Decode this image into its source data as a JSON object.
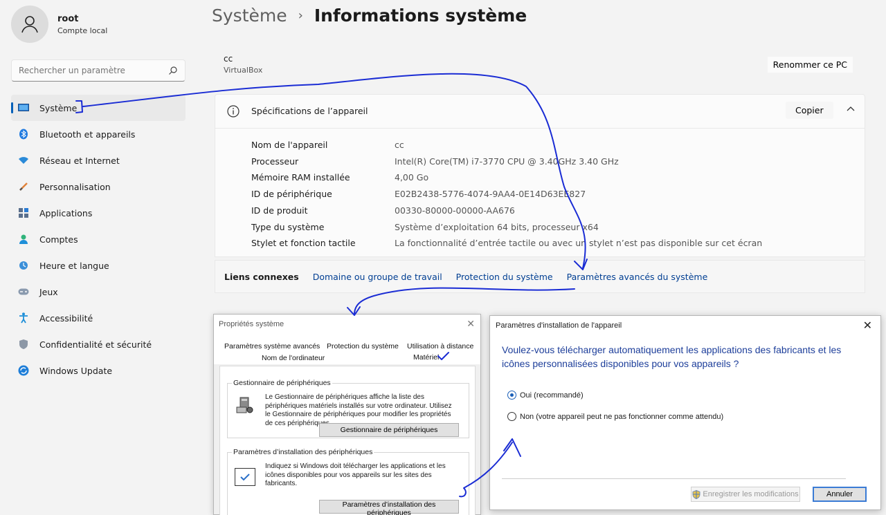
{
  "user": {
    "name": "root",
    "subtitle": "Compte local"
  },
  "search": {
    "placeholder": "Rechercher un paramètre"
  },
  "nav": {
    "items": [
      {
        "label": "Système",
        "icon": "monitor-icon",
        "active": true
      },
      {
        "label": "Bluetooth et appareils",
        "icon": "bluetooth-icon"
      },
      {
        "label": "Réseau et Internet",
        "icon": "wifi-icon"
      },
      {
        "label": "Personnalisation",
        "icon": "brush-icon"
      },
      {
        "label": "Applications",
        "icon": "apps-icon"
      },
      {
        "label": "Comptes",
        "icon": "person-icon"
      },
      {
        "label": "Heure et langue",
        "icon": "globe-clock-icon"
      },
      {
        "label": "Jeux",
        "icon": "gamepad-icon"
      },
      {
        "label": "Accessibilité",
        "icon": "accessibility-icon"
      },
      {
        "label": "Confidentialité et sécurité",
        "icon": "shield-icon"
      },
      {
        "label": "Windows Update",
        "icon": "update-icon"
      }
    ]
  },
  "breadcrumb": {
    "parent": "Système",
    "separator": "›",
    "current": "Informations système"
  },
  "pc": {
    "name": "cc",
    "model": "VirtualBox",
    "rename_label": "Renommer ce PC"
  },
  "specs": {
    "title": "Spécifications de l’appareil",
    "copy_label": "Copier",
    "rows": [
      {
        "label": "Nom de l'appareil",
        "value": "cc"
      },
      {
        "label": "Processeur",
        "value": "Intel(R) Core(TM) i7-3770 CPU @ 3.40GHz   3.40 GHz"
      },
      {
        "label": "Mémoire RAM installée",
        "value": "4,00 Go"
      },
      {
        "label": "ID de périphérique",
        "value": "E02B2438-5776-4074-9AA4-0E14D63EE827"
      },
      {
        "label": "ID de produit",
        "value": "00330-80000-00000-AA676"
      },
      {
        "label": "Type du système",
        "value": "Système d’exploitation 64 bits, processeur x64"
      },
      {
        "label": "Stylet et fonction tactile",
        "value": "La fonctionnalité d’entrée tactile ou avec un stylet n’est pas disponible sur cet écran"
      }
    ]
  },
  "related": {
    "label": "Liens connexes",
    "links": [
      "Domaine ou groupe de travail",
      "Protection du système",
      "Paramètres avancés du système"
    ]
  },
  "sysprop": {
    "title": "Propriétés système",
    "tabs": [
      "Paramètres système avancés",
      "Protection du système",
      "Utilisation à distance",
      "Nom de l'ordinateur",
      "Matériel"
    ],
    "device_manager": {
      "title": "Gestionnaire de périphériques",
      "text": "Le Gestionnaire de périphériques affiche la liste des périphériques matériels installés sur votre ordinateur. Utilisez le Gestionnaire de périphériques pour modifier les propriétés de ces périphériques.",
      "button": "Gestionnaire de périphériques"
    },
    "install_settings": {
      "title": "Paramètres d’installation des périphériques",
      "text": "Indiquez si Windows doit télécharger les applications et les icônes disponibles pour vos appareils sur les sites des fabricants.",
      "button": "Paramètres d’installation des périphériques"
    }
  },
  "device_dialog": {
    "title": "Paramètres d'installation de l'appareil",
    "question": "Voulez-vous télécharger automatiquement les applications des fabricants et les icônes personnalisées disponibles pour vos appareils ?",
    "options": [
      {
        "label": "Oui (recommandé)",
        "selected": true
      },
      {
        "label": "Non (votre appareil peut ne pas fonctionner comme attendu)",
        "selected": false
      }
    ],
    "save_label": "Enregistrer les modifications",
    "cancel_label": "Annuler"
  },
  "colors": {
    "accent": "#005fb8",
    "link": "#003e92",
    "annotation": "#1a2cd4",
    "question": "#1d3e9a"
  }
}
